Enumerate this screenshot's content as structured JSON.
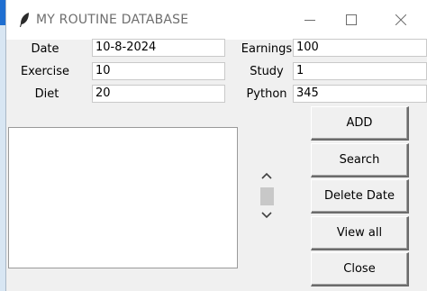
{
  "window": {
    "title": "MY ROUTINE DATABASE",
    "controls": {
      "minimize_icon": "minimize-icon",
      "maximize_icon": "maximize-icon",
      "close_icon": "close-icon"
    },
    "title_icon": "feather-icon"
  },
  "form": {
    "date": {
      "label": "Date",
      "value": "10-8-2024"
    },
    "exercise": {
      "label": "Exercise",
      "value": "10"
    },
    "diet": {
      "label": "Diet",
      "value": "20"
    },
    "earnings": {
      "label": "Earnings",
      "value": "100"
    },
    "study": {
      "label": "Study",
      "value": "1"
    },
    "python": {
      "label": "Python",
      "value": "345"
    }
  },
  "buttons": {
    "add": "ADD",
    "search": "Search",
    "delete_date": "Delete Date",
    "view_all": "View all",
    "close": "Close"
  },
  "listbox": {
    "items": []
  },
  "colors": {
    "window_bg": "#f0f0f0",
    "titlebar_bg": "#ffffff",
    "title_text": "#6e6e6e",
    "desktop_accent": "#1f6fd1"
  }
}
